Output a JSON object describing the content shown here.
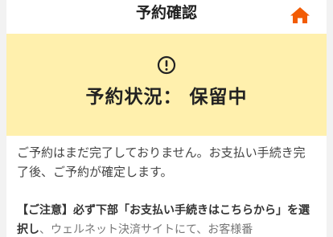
{
  "header": {
    "title": "予約確認",
    "home_icon": "home-icon",
    "home_color": "#f25c05"
  },
  "status": {
    "icon": "exclamation-circle-icon",
    "text": "予約状況： 保留中",
    "background": "#fff0ad"
  },
  "message": {
    "text": "ご予約はまだ完了しておりません。お支払い手続き完了後、ご予約が確定します。"
  },
  "notice": {
    "bold_text": "【ご注意】必ず下部「お支払い手続きはこちらから」を選択し",
    "rest_text": "、ウェルネット決済サイトにて、お客様番"
  }
}
